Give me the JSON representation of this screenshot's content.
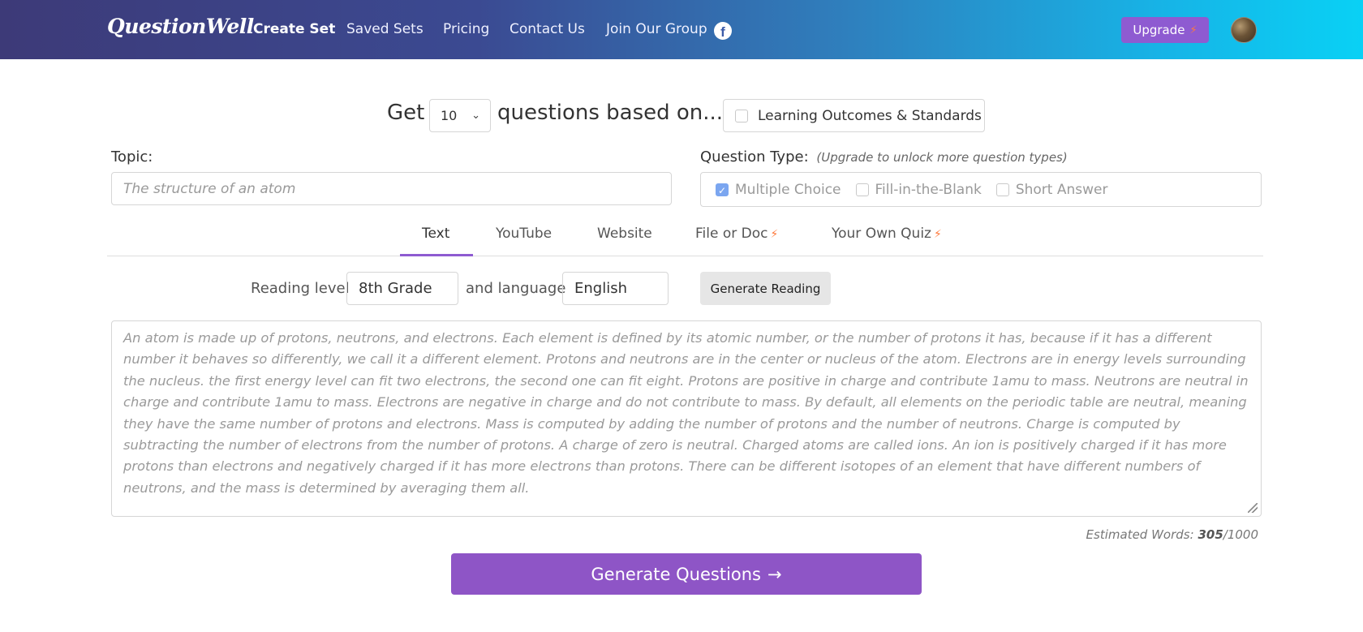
{
  "navbar": {
    "logo": "QuestionWell",
    "items": [
      "Create Set",
      "Saved Sets",
      "Pricing",
      "Contact Us",
      "Join Our Group"
    ],
    "facebook_icon": "f",
    "upgrade_label": "Upgrade",
    "bolt_icon": "⚡"
  },
  "generator": {
    "get_word": "Get",
    "count": "10",
    "based_on": "questions based on...",
    "learning_outcomes_label": "Learning Outcomes & Standards"
  },
  "topic": {
    "label": "Topic:",
    "placeholder": "The structure of an atom"
  },
  "question_type": {
    "label": "Question Type:",
    "note": "(Upgrade to unlock more question types)",
    "options": [
      {
        "label": "Multiple Choice",
        "checked": true
      },
      {
        "label": "Fill-in-the-Blank",
        "checked": false
      },
      {
        "label": "Short Answer",
        "checked": false
      }
    ]
  },
  "tabs": [
    "Text",
    "YouTube",
    "Website",
    "File or Doc",
    "Your Own Quiz"
  ],
  "reading": {
    "level_label": "Reading level",
    "level_value": "8th Grade",
    "language_label": "and language",
    "language_value": "English",
    "generate_label": "Generate Reading"
  },
  "text_source": {
    "placeholder": "An atom is made up of protons, neutrons, and electrons. Each element is defined by its atomic number, or the number of protons it has, because if it has a different number it behaves so differently, we call it a different element. Protons and neutrons are in the center or nucleus of the atom. Electrons are in energy levels surrounding the nucleus. the first energy level can fit two electrons, the second one can fit eight. Protons are positive in charge and contribute 1amu to mass. Neutrons are neutral in charge and contribute 1amu to mass. Electrons are negative in charge and do not contribute to mass. By default, all elements on the periodic table are neutral, meaning they have the same number of protons and electrons. Mass is computed by adding the number of protons and the number of neutrons. Charge is computed by subtracting the number of electrons from the number of protons. A charge of zero is neutral. Charged atoms are called ions. An ion is positively charged if it has more protons than electrons and negatively charged if it has more electrons than protons. There can be different isotopes of an element that have different numbers of neutrons, and the mass is determined by averaging them all.",
    "est_label": "Estimated Words:",
    "est_count": "305",
    "est_max": "/1000"
  },
  "generate_button": {
    "label": "Generate Questions",
    "arrow": "→"
  },
  "colors": {
    "accent": "#8e5bd1",
    "bolt": "#ff7a3d",
    "checkbox_checked": "#7ba6f0"
  }
}
